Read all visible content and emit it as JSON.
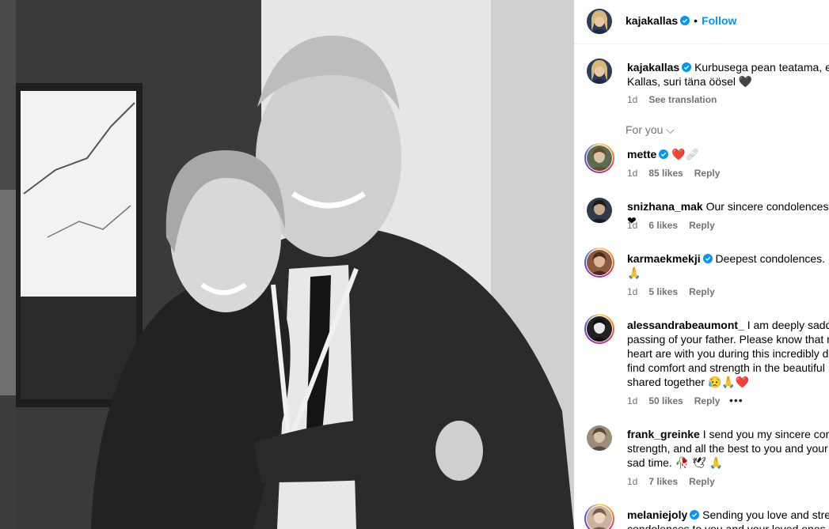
{
  "post": {
    "author": "kajakallas",
    "follow_label": "Follow",
    "separator": "•",
    "caption_user": "kajakallas",
    "caption_text": "Kurbusega pean teatama, et\nKallas, suri täna öösel 🖤",
    "caption_age": "1d",
    "see_translation": "See translation",
    "photo_alt": "Black and white photo of a woman hugging a smiling man in a suit"
  },
  "filter_label": "For you ⌵",
  "comments": [
    {
      "user": "mette",
      "verified": true,
      "text": "❤️🩹",
      "age": "1d",
      "likes": "85 likes",
      "reply": "Reply",
      "story_ring": true
    },
    {
      "user": "snizhana_mak",
      "verified": false,
      "text": "Our sincere condolences ❤",
      "age": "1d",
      "likes": "6 likes",
      "reply": "Reply",
      "story_ring": false
    },
    {
      "user": "karmaekmekji",
      "verified": true,
      "text": "Deepest condolences. M\n🙏",
      "age": "1d",
      "likes": "5 likes",
      "reply": "Reply",
      "story_ring": true
    },
    {
      "user": "alessandrabeaumont_",
      "verified": false,
      "text": "I am deeply sadde\npassing of your father. Please know that m\nheart are with you during this incredibly d\nfind comfort and strength in the beautiful\nshared together 😥🙏❤️",
      "age": "1d",
      "likes": "50 likes",
      "reply": "Reply",
      "story_ring": true,
      "more": "•••"
    },
    {
      "user": "frank_greinke",
      "verified": false,
      "text": "I send you my sincere cond\nstrength, and all the best to you and your\nsad time. 🥀 🕊 🙏",
      "age": "1d",
      "likes": "7 likes",
      "reply": "Reply",
      "story_ring": false
    },
    {
      "user": "melaniejoly",
      "verified": true,
      "text": "Sending you love and stren\ncondolences to you and your loved ones",
      "age": "",
      "likes": "",
      "reply": "",
      "story_ring": true
    }
  ],
  "colors": {
    "accent": "#0095f6",
    "muted": "#737373",
    "verified": "#0095f6"
  }
}
